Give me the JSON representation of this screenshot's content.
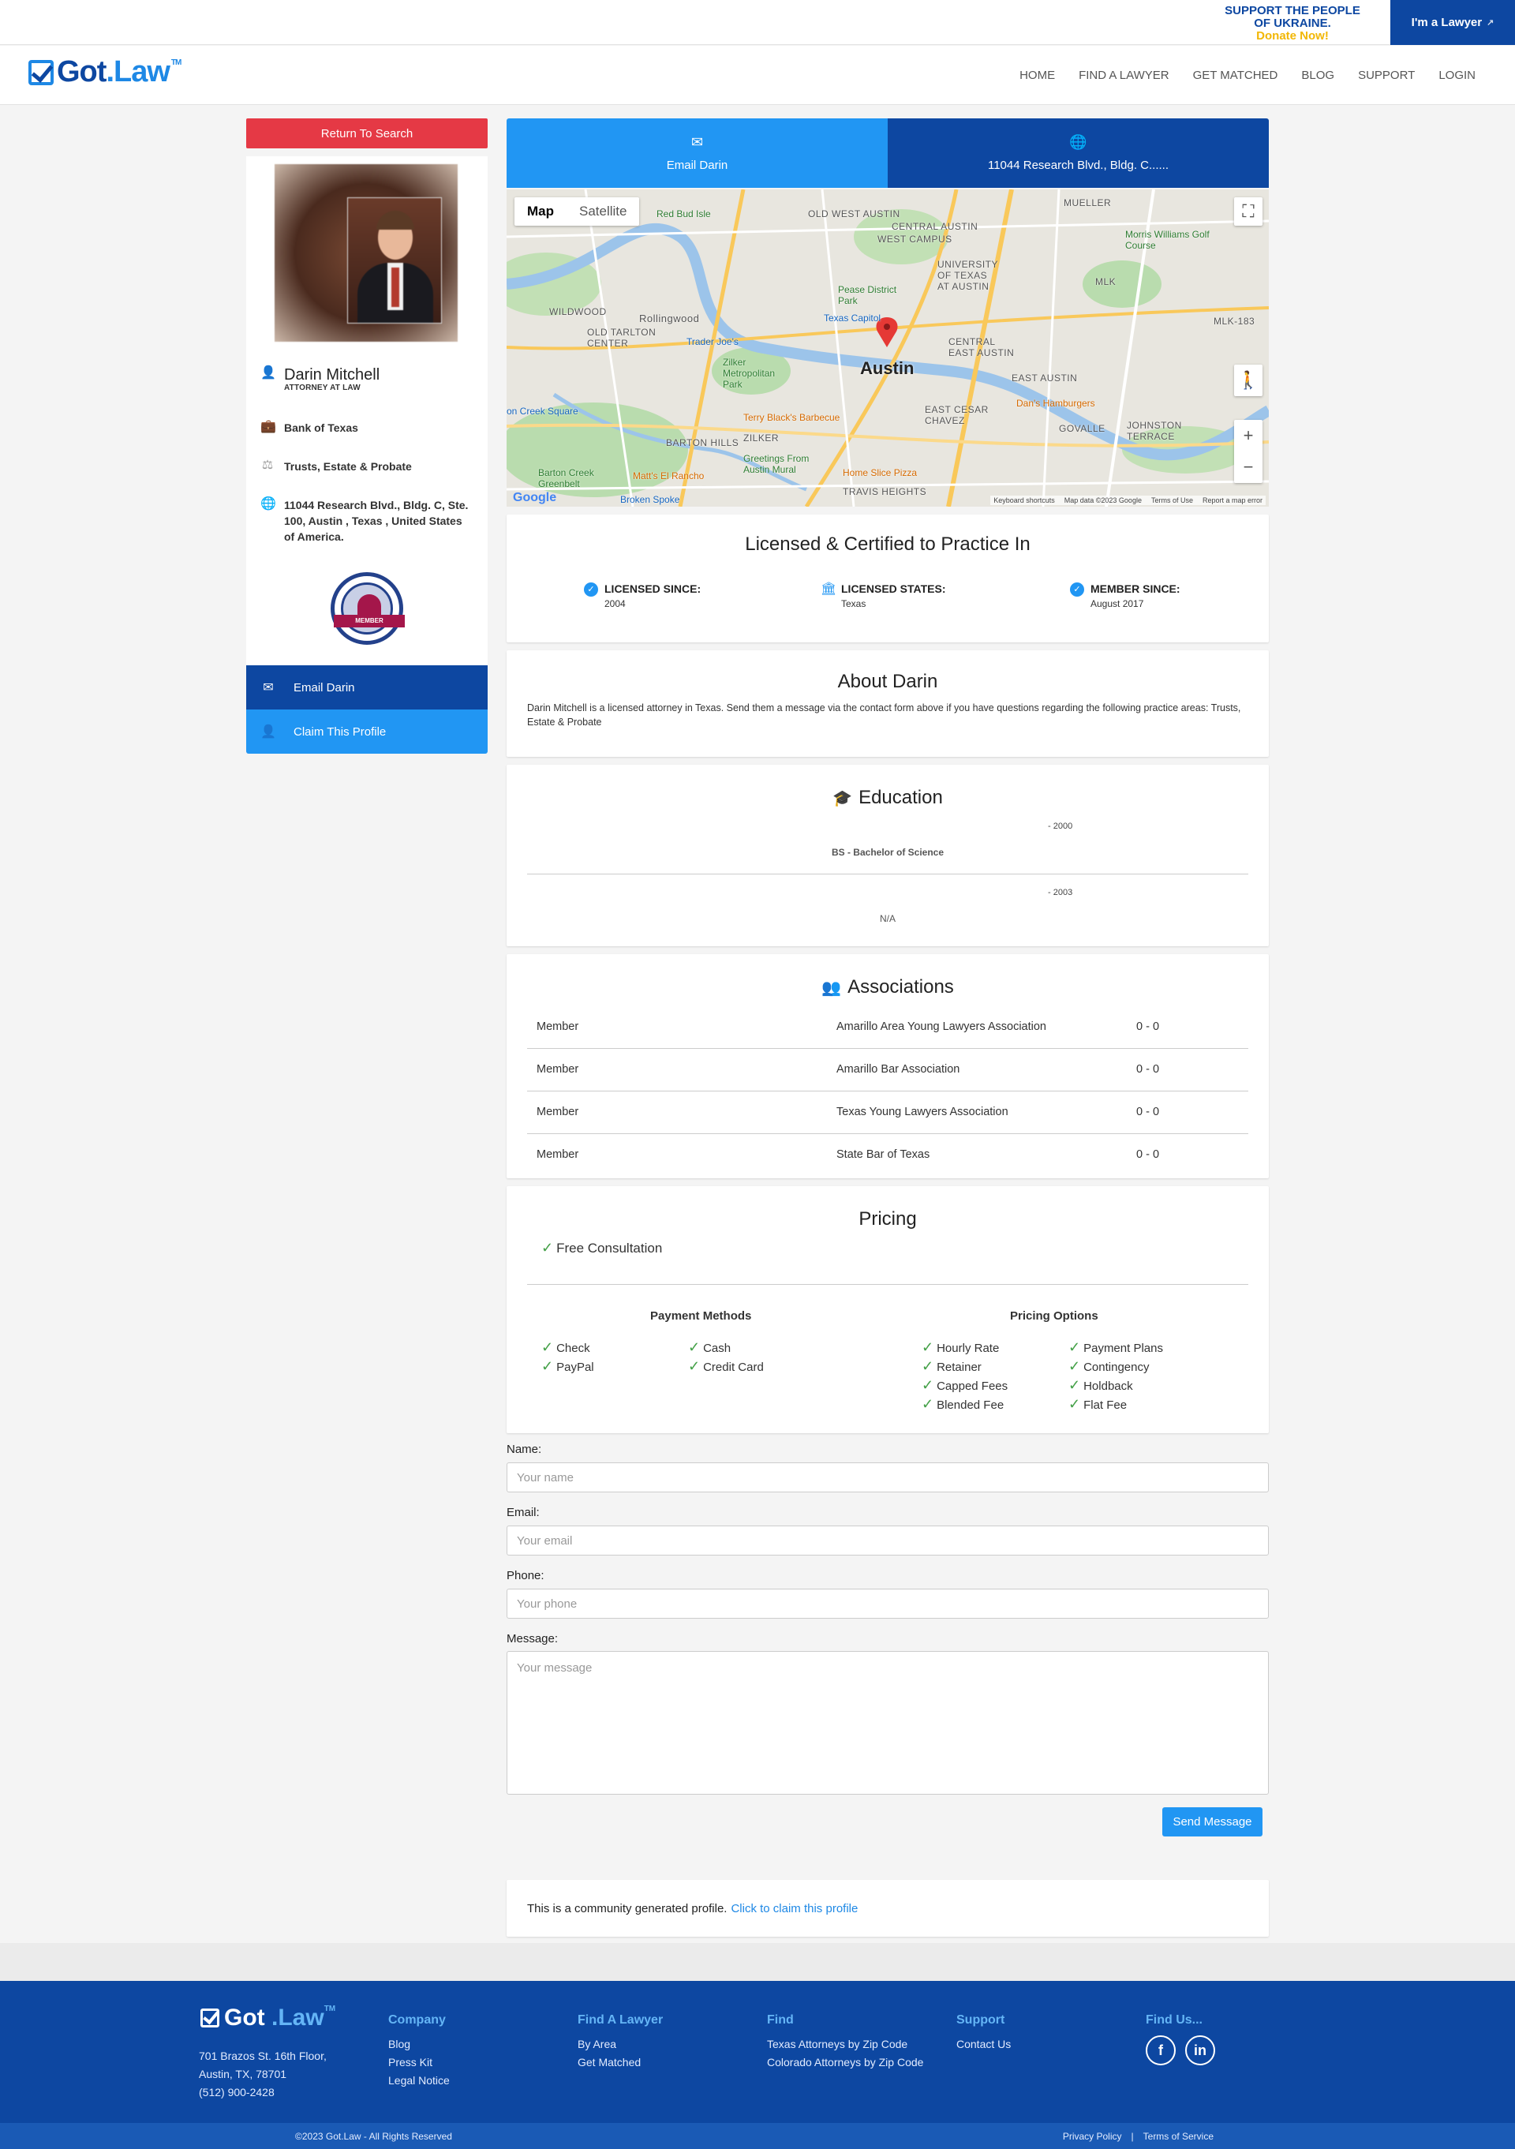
{
  "topbar": {
    "ukraine_line1": "SUPPORT THE PEOPLE",
    "ukraine_line2": "OF UKRAINE.",
    "donate": "Donate Now!",
    "lawyer_button": "I'm a Lawyer"
  },
  "nav": {
    "logo_got": "Got",
    "logo_law": ".Law",
    "logo_tm": "TM",
    "links": [
      "HOME",
      "FIND A LAWYER",
      "GET MATCHED",
      "BLOG",
      "SUPPORT",
      "LOGIN"
    ]
  },
  "sidebar": {
    "return_button": "Return To Search",
    "name": "Darin Mitchell",
    "title": "ATTORNEY AT LAW",
    "firm": "Bank of Texas",
    "practice": "Trusts, Estate & Probate",
    "address": "11044 Research Blvd., Bldg. C, Ste. 100, Austin , Texas , United States of America.",
    "badge_text": "MEMBER",
    "email_button": "Email Darin",
    "claim_button": "Claim This Profile"
  },
  "tabs": {
    "email": "Email Darin",
    "address": "11044 Research Blvd., Bldg. C......"
  },
  "map": {
    "toggle_map": "Map",
    "toggle_satellite": "Satellite",
    "city": "Austin",
    "labels": [
      "OLD WEST AUSTIN",
      "WEST CAMPUS",
      "CENTRAL AUSTIN",
      "UNIVERSITY OF TEXAS AT AUSTIN",
      "MLK",
      "MLK-183",
      "WILDWOOD",
      "OLD TARLTON CENTER",
      "CENTRAL EAST AUSTIN",
      "EAST AUSTIN",
      "EAST CESAR CHAVEZ",
      "GOVALLE",
      "JOHNSTON TERRACE",
      "BARTON HILLS",
      "ZILKER",
      "TRAVIS HEIGHTS",
      "Rollingwood",
      "MUELLER"
    ],
    "pois": [
      "Red Bud Isle",
      "Pease District Park",
      "Texas Capitol",
      "Trader Joe's",
      "Zilker Metropolitan Park",
      "Terry Black's Barbecue",
      "Dan's Hamburgers",
      "Morris Williams Golf Course",
      "Barton Creek Greenbelt",
      "Greetings From Austin Mural",
      "Home Slice Pizza",
      "Matt's El Rancho",
      "Broken Spoke",
      "on Creek Square"
    ],
    "google": "Google",
    "footer_items": [
      "Keyboard shortcuts",
      "Map data ©2023 Google",
      "Terms of Use",
      "Report a map error"
    ]
  },
  "licensed": {
    "title": "Licensed & Certified to Practice In",
    "items": [
      {
        "label": "LICENSED SINCE:",
        "value": "2004"
      },
      {
        "label": "LICENSED STATES:",
        "value": "Texas"
      },
      {
        "label": "MEMBER SINCE:",
        "value": "August 2017"
      }
    ]
  },
  "about": {
    "title": "About Darin",
    "text": "Darin Mitchell is a licensed attorney in Texas. Send them a message via the contact form above if you have questions regarding the following practice areas: Trusts, Estate & Probate"
  },
  "education": {
    "title": "Education",
    "items": [
      {
        "year": "- 2000",
        "degree": "BS - Bachelor of Science"
      },
      {
        "year": "- 2003",
        "degree": "N/A"
      }
    ]
  },
  "associations": {
    "title": "Associations",
    "rows": [
      {
        "role": "Member",
        "name": "Amarillo Area Young Lawyers Association",
        "years": "0 - 0"
      },
      {
        "role": "Member",
        "name": "Amarillo Bar Association",
        "years": "0 - 0"
      },
      {
        "role": "Member",
        "name": "Texas Young Lawyers Association",
        "years": "0 - 0"
      },
      {
        "role": "Member",
        "name": "State Bar of Texas",
        "years": "0 - 0"
      }
    ]
  },
  "pricing": {
    "title": "Pricing",
    "free": "Free Consultation",
    "payment_head": "Payment Methods",
    "payment": [
      "Check",
      "Cash",
      "PayPal",
      "Credit Card"
    ],
    "options_head": "Pricing Options",
    "options": [
      "Hourly Rate",
      "Payment Plans",
      "Retainer",
      "Contingency",
      "Capped Fees",
      "Holdback",
      "Blended Fee",
      "Flat Fee"
    ]
  },
  "form": {
    "name_label": "Name:",
    "name_placeholder": "Your name",
    "email_label": "Email:",
    "email_placeholder": "Your email",
    "phone_label": "Phone:",
    "phone_placeholder": "Your phone",
    "message_label": "Message:",
    "message_placeholder": "Your message",
    "send": "Send Message"
  },
  "community": {
    "text": "This is a community generated profile.",
    "link": "Click to claim this profile"
  },
  "footer": {
    "address_line1": "701 Brazos St. 16th Floor,",
    "address_line2": "Austin, TX, 78701",
    "phone": "(512) 900-2428",
    "company_head": "Company",
    "company": [
      "Blog",
      "Press Kit",
      "Legal Notice"
    ],
    "find_lawyer_head": "Find A Lawyer",
    "find_lawyer": [
      "By Area",
      "Get Matched"
    ],
    "find_head": "Find",
    "find": [
      "Texas Attorneys by Zip Code",
      "Colorado Attorneys by Zip Code"
    ],
    "support_head": "Support",
    "support": [
      "Contact Us"
    ],
    "findus_head": "Find Us...",
    "social": [
      "f",
      "in"
    ],
    "copyright": "©2023 Got.Law - All Rights Reserved",
    "privacy": "Privacy Policy",
    "separator": "|",
    "terms": "Terms of Service"
  }
}
